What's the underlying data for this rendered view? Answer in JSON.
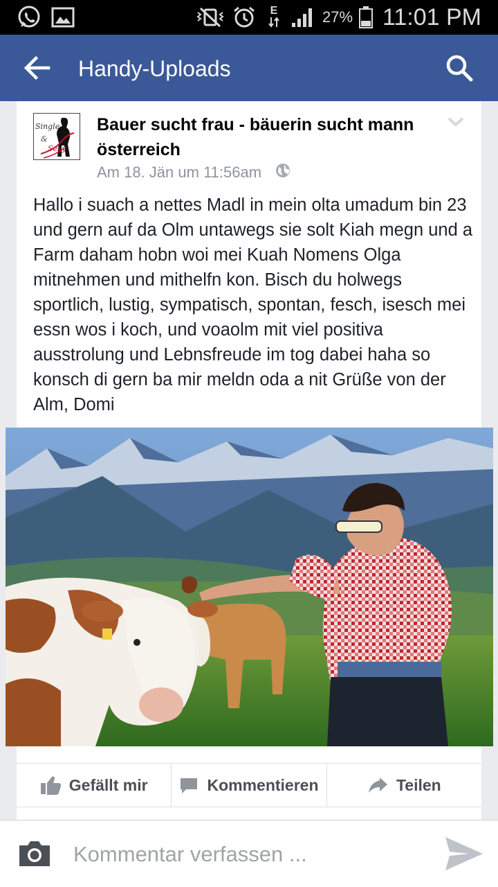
{
  "status_bar": {
    "battery_percent": "27%",
    "time": "11:01 PM",
    "network_label": "E"
  },
  "app_bar": {
    "title": "Handy-Uploads"
  },
  "post": {
    "avatar_text": "Single & Sexy",
    "author": "Bauer sucht frau - bäuerin sucht mann österreich",
    "timestamp": "Am 18. Jän um 11:56am",
    "text": "Hallo i suach a nettes Madl in mein olta umadum bin 23 und gern auf da Olm untawegs sie solt Kiah megn und a Farm daham hobn woi mei Kuah Nomens Olga mitnehmen und mithelfn kon. Bisch du holwegs sportlich, lustig, sympatisch, spontan, fesch, isesch mei essn wos i koch, und voaolm mit viel positiva ausstrolung und Lebnsfreude im tog dabei haha so konsch di gern ba mir meldn oda a nit Grüße von der Alm, Domi"
  },
  "actions": {
    "like": "Gefällt mir",
    "comment": "Kommentieren",
    "share": "Teilen"
  },
  "composer": {
    "placeholder": "Kommentar verfassen ..."
  },
  "colors": {
    "app_bar": "#3b5998",
    "action_text": "#4b4f56",
    "meta_text": "#8d949e"
  }
}
